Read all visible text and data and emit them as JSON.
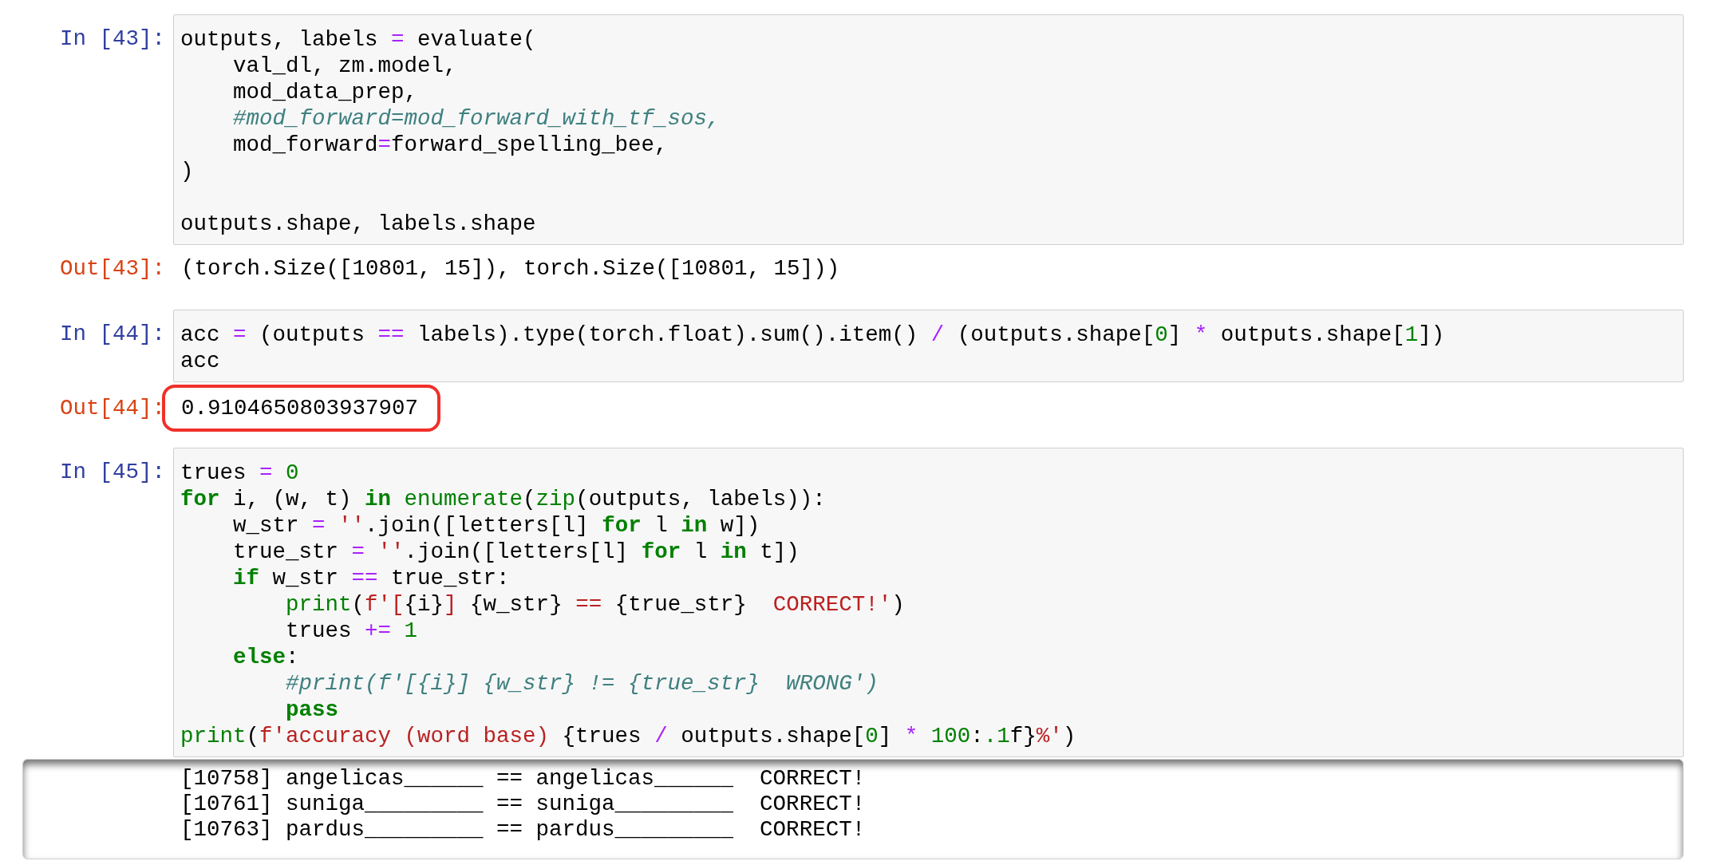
{
  "cells": [
    {
      "kind": "code",
      "prompt": "In [43]:",
      "blocks": [
        [
          [
            {
              "kind": "t",
              "s": "outputs, labels "
            },
            {
              "kind": "op",
              "s": "="
            },
            {
              "kind": "t",
              "s": " evaluate("
            }
          ],
          [
            {
              "kind": "t",
              "s": "    val_dl, zm.model,"
            }
          ],
          [
            {
              "kind": "t",
              "s": "    mod_data_prep,"
            }
          ],
          [
            {
              "kind": "cm",
              "s": "    #mod_forward=mod_forward_with_tf_sos,"
            }
          ],
          [
            {
              "kind": "t",
              "s": "    mod_forward"
            },
            {
              "kind": "op",
              "s": "="
            },
            {
              "kind": "t",
              "s": "forward_spelling_bee,"
            }
          ],
          [
            {
              "kind": "t",
              "s": ")"
            }
          ]
        ],
        [
          [
            {
              "kind": "t",
              "s": "outputs.shape, labels.shape"
            }
          ]
        ]
      ]
    },
    {
      "kind": "result",
      "prompt": "Out[43]:",
      "text": "(torch.Size([10801, 15]), torch.Size([10801, 15]))",
      "circled": false
    },
    {
      "kind": "code",
      "prompt": "In [44]:",
      "blocks": [
        [
          [
            {
              "kind": "t",
              "s": "acc "
            },
            {
              "kind": "op",
              "s": "="
            },
            {
              "kind": "t",
              "s": " (outputs "
            },
            {
              "kind": "op",
              "s": "=="
            },
            {
              "kind": "t",
              "s": " labels).type(torch.float).sum().item() "
            },
            {
              "kind": "op",
              "s": "/"
            },
            {
              "kind": "t",
              "s": " (outputs.shape["
            },
            {
              "kind": "num",
              "s": "0"
            },
            {
              "kind": "t",
              "s": "] "
            },
            {
              "kind": "op",
              "s": "*"
            },
            {
              "kind": "t",
              "s": " outputs.shape["
            },
            {
              "kind": "num",
              "s": "1"
            },
            {
              "kind": "t",
              "s": "])"
            }
          ],
          [
            {
              "kind": "t",
              "s": "acc"
            }
          ]
        ]
      ]
    },
    {
      "kind": "result",
      "prompt": "Out[44]:",
      "text": "0.9104650803937907",
      "circled": true
    },
    {
      "kind": "code",
      "prompt": "In [45]:",
      "blocks": [
        [
          [
            {
              "kind": "t",
              "s": "trues "
            },
            {
              "kind": "op",
              "s": "="
            },
            {
              "kind": "num",
              "s": " 0"
            }
          ],
          [
            {
              "kind": "kw",
              "s": "for"
            },
            {
              "kind": "t",
              "s": " i, (w, t) "
            },
            {
              "kind": "kw",
              "s": "in"
            },
            {
              "kind": "bi",
              "s": " enumerate"
            },
            {
              "kind": "t",
              "s": "("
            },
            {
              "kind": "bi",
              "s": "zip"
            },
            {
              "kind": "t",
              "s": "(outputs, labels)):"
            }
          ],
          [
            {
              "kind": "t",
              "s": "    w_str "
            },
            {
              "kind": "op",
              "s": "="
            },
            {
              "kind": "str",
              "s": " ''"
            },
            {
              "kind": "t",
              "s": ".join([letters[l] "
            },
            {
              "kind": "kw",
              "s": "for"
            },
            {
              "kind": "t",
              "s": " l "
            },
            {
              "kind": "kw",
              "s": "in"
            },
            {
              "kind": "t",
              "s": " w])"
            }
          ],
          [
            {
              "kind": "t",
              "s": "    true_str "
            },
            {
              "kind": "op",
              "s": "="
            },
            {
              "kind": "str",
              "s": " ''"
            },
            {
              "kind": "t",
              "s": ".join([letters[l] "
            },
            {
              "kind": "kw",
              "s": "for"
            },
            {
              "kind": "t",
              "s": " l "
            },
            {
              "kind": "kw",
              "s": "in"
            },
            {
              "kind": "t",
              "s": " t])"
            }
          ],
          [
            {
              "kind": "kw",
              "s": "    if"
            },
            {
              "kind": "t",
              "s": " w_str "
            },
            {
              "kind": "op",
              "s": "=="
            },
            {
              "kind": "t",
              "s": " true_str:"
            }
          ],
          [
            {
              "kind": "bi",
              "s": "        print"
            },
            {
              "kind": "t",
              "s": "("
            },
            {
              "kind": "str",
              "s": "f'["
            },
            {
              "kind": "t",
              "s": "{i}"
            },
            {
              "kind": "str",
              "s": "] "
            },
            {
              "kind": "t",
              "s": "{w_str}"
            },
            {
              "kind": "str",
              "s": " == "
            },
            {
              "kind": "t",
              "s": "{true_str}"
            },
            {
              "kind": "str",
              "s": "  CORRECT!'"
            },
            {
              "kind": "t",
              "s": ")"
            }
          ],
          [
            {
              "kind": "t",
              "s": "        trues "
            },
            {
              "kind": "op",
              "s": "+="
            },
            {
              "kind": "num",
              "s": " 1"
            }
          ],
          [
            {
              "kind": "kw",
              "s": "    else"
            },
            {
              "kind": "t",
              "s": ":"
            }
          ],
          [
            {
              "kind": "cm",
              "s": "        #print(f'[{i}] {w_str} != {true_str}  WRONG')"
            }
          ],
          [
            {
              "kind": "kw",
              "s": "        pass"
            }
          ],
          [
            {
              "kind": "bi",
              "s": "print"
            },
            {
              "kind": "t",
              "s": "("
            },
            {
              "kind": "str",
              "s": "f'accuracy (word base) "
            },
            {
              "kind": "t",
              "s": "{trues "
            },
            {
              "kind": "op",
              "s": "/"
            },
            {
              "kind": "t",
              "s": " outputs.shape["
            },
            {
              "kind": "num",
              "s": "0"
            },
            {
              "kind": "t",
              "s": "] "
            },
            {
              "kind": "op",
              "s": "*"
            },
            {
              "kind": "num",
              "s": " 100"
            },
            {
              "kind": "t",
              "s": ":"
            },
            {
              "kind": "num",
              "s": ".1"
            },
            {
              "kind": "t",
              "s": "f}"
            },
            {
              "kind": "str",
              "s": "%'"
            },
            {
              "kind": "t",
              "s": ")"
            }
          ]
        ]
      ]
    },
    {
      "kind": "stream",
      "lines": [
        "[10758] angelicas______ == angelicas______  CORRECT!",
        "[10761] suniga_________ == suniga_________  CORRECT!",
        "[10763] pardus_________ == pardus_________  CORRECT!"
      ]
    }
  ]
}
